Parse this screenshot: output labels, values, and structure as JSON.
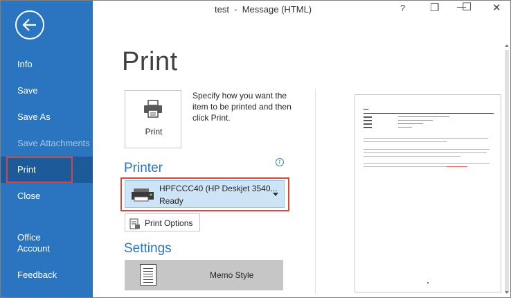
{
  "window": {
    "title": "test  -  Message (HTML)",
    "help": "?",
    "restore": "❒",
    "minimize": "—",
    "maximize": "☐",
    "close": "✕"
  },
  "sidebar": {
    "back_icon": "back-arrow-icon",
    "items": [
      {
        "label": "Info",
        "state": "normal"
      },
      {
        "label": "Save",
        "state": "normal"
      },
      {
        "label": "Save As",
        "state": "normal"
      },
      {
        "label": "Save Attachments",
        "state": "disabled"
      },
      {
        "label": "Print",
        "state": "selected"
      },
      {
        "label": "Close",
        "state": "normal"
      },
      {
        "label": "Office\nAccount",
        "state": "normal"
      },
      {
        "label": "Feedback",
        "state": "normal"
      }
    ],
    "office_line1": "Office",
    "office_line2": "Account"
  },
  "main": {
    "title": "Print",
    "print_button_label": "Print",
    "print_description": "Specify how you want the item to be printed and then click Print.",
    "printer_heading": "Printer",
    "info_icon_glyph": "i",
    "printer": {
      "name": "HPFCCC40 (HP Deskjet 3540...",
      "status": "Ready"
    },
    "print_options_label": "Print Options",
    "settings_heading": "Settings",
    "style_label": "Memo Style"
  },
  "preview": {
    "from_label": "test"
  },
  "colors": {
    "sidebar_bg": "#2b75c0",
    "sidebar_selected": "#1d5a99",
    "accent": "#2b75c0",
    "highlight_border": "#d9463b",
    "printer_dropdown_bg": "#cde4f7"
  }
}
